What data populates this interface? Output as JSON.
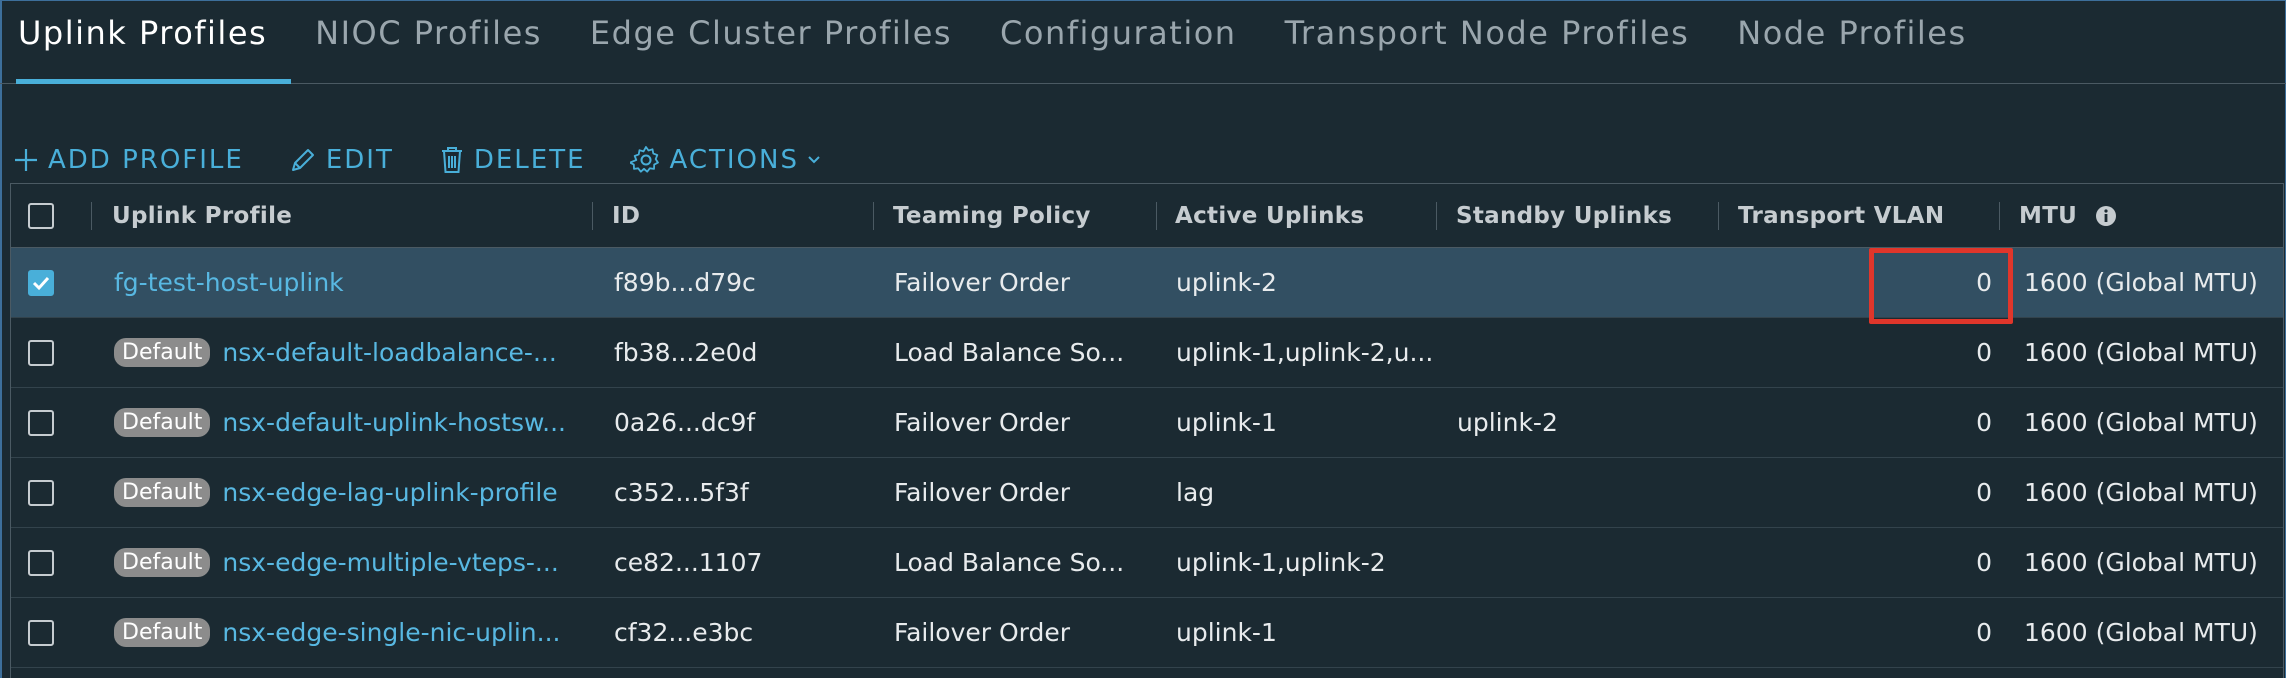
{
  "tabs": [
    {
      "label": "Uplink Profiles",
      "active": true
    },
    {
      "label": "NIOC Profiles",
      "active": false
    },
    {
      "label": "Edge Cluster Profiles",
      "active": false
    },
    {
      "label": "Configuration",
      "active": false
    },
    {
      "label": "Transport Node Profiles",
      "active": false
    },
    {
      "label": "Node Profiles",
      "active": false
    }
  ],
  "toolbar": {
    "add_label": "ADD PROFILE",
    "edit_label": "EDIT",
    "delete_label": "DELETE",
    "actions_label": "ACTIONS"
  },
  "table": {
    "headers": {
      "uplink_profile": "Uplink Profile",
      "id": "ID",
      "teaming_policy": "Teaming Policy",
      "active_uplinks": "Active Uplinks",
      "standby_uplinks": "Standby Uplinks",
      "transport_vlan": "Transport VLAN",
      "mtu": "MTU"
    },
    "rows": [
      {
        "checked": true,
        "badge": "",
        "name": "fg-test-host-uplink",
        "id": "f89b...d79c",
        "teaming": "Failover Order",
        "active": "uplink-2",
        "standby": "",
        "vlan": "0",
        "mtu": "1600 (Global MTU)"
      },
      {
        "checked": false,
        "badge": "Default",
        "name": "nsx-default-loadbalance-...",
        "id": "fb38...2e0d",
        "teaming": "Load Balance So...",
        "active": "uplink-1,uplink-2,u...",
        "standby": "",
        "vlan": "0",
        "mtu": "1600 (Global MTU)"
      },
      {
        "checked": false,
        "badge": "Default",
        "name": "nsx-default-uplink-hostsw...",
        "id": "0a26...dc9f",
        "teaming": "Failover Order",
        "active": "uplink-1",
        "standby": "uplink-2",
        "vlan": "0",
        "mtu": "1600 (Global MTU)"
      },
      {
        "checked": false,
        "badge": "Default",
        "name": "nsx-edge-lag-uplink-profile",
        "id": "c352...5f3f",
        "teaming": "Failover Order",
        "active": "lag",
        "standby": "",
        "vlan": "0",
        "mtu": "1600 (Global MTU)"
      },
      {
        "checked": false,
        "badge": "Default",
        "name": "nsx-edge-multiple-vteps-...",
        "id": "ce82...1107",
        "teaming": "Load Balance So...",
        "active": "uplink-1,uplink-2",
        "standby": "",
        "vlan": "0",
        "mtu": "1600 (Global MTU)"
      },
      {
        "checked": false,
        "badge": "Default",
        "name": "nsx-edge-single-nic-uplin...",
        "id": "cf32...e3bc",
        "teaming": "Failover Order",
        "active": "uplink-1",
        "standby": "",
        "vlan": "0",
        "mtu": "1600 (Global MTU)"
      }
    ]
  },
  "colors": {
    "background": "#1b2a32",
    "accent": "#49afd9",
    "selected_row": "#324f62",
    "highlight": "#e0362b",
    "badge": "#8c8c8c"
  },
  "icons": {
    "add": "plus-icon",
    "edit": "pencil-icon",
    "delete": "trash-icon",
    "actions": "gear-icon",
    "actions_caret": "chevron-down-icon",
    "mtu_info": "info-icon",
    "checked": "checkmark-icon"
  }
}
